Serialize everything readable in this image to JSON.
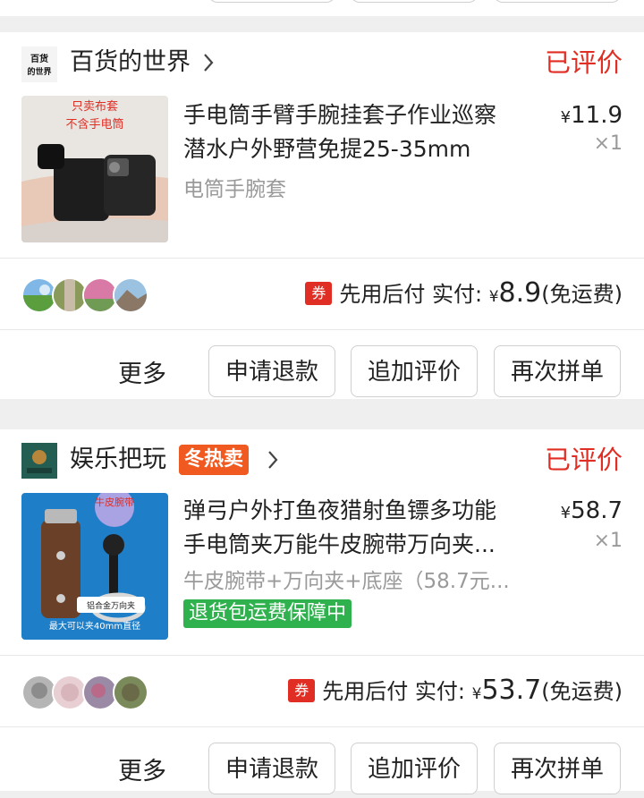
{
  "orders": [
    {
      "shop_name": "百货的世界",
      "shop_logo_text": "百货的世界",
      "status": "已评价",
      "title_line1": "手电筒手臂手腕挂套子作业巡察",
      "title_line2": "潜水户外野营免提25-35mm",
      "sku": "电筒手腕套",
      "price_symbol": "¥",
      "price": "11.9",
      "quantity": "×1",
      "image_text": "只卖布套 不含手电筒",
      "image_text_line1": "只卖布套",
      "image_text_line2": "不含手电筒",
      "coupon_icon": "券",
      "pay_label": "先用后付 实付:",
      "pay_symbol": "¥",
      "pay_amount": "8.9",
      "pay_note": "(免运费)",
      "more": "更多",
      "buttons": [
        "申请退款",
        "追加评价",
        "再次拼单"
      ]
    },
    {
      "shop_name": "娱乐把玩",
      "badge": "冬热卖",
      "status": "已评价",
      "title_line1": "弹弓户外打鱼夜猎射鱼镖多功能",
      "title_line2": "手电筒夹万能牛皮腕带万向夹...",
      "sku": "牛皮腕带+万向夹+底座（58.7元...",
      "guarantee": "退货包运费保障中",
      "price_symbol": "¥",
      "price": "58.7",
      "quantity": "×1",
      "image_text": "牛皮腕带 铝合金万向夹 最大可以夹40mm直径",
      "image_text_top": "牛皮腕带",
      "image_text_mid": "铝合金万向夹",
      "image_text_bottom": "最大可以夹40mm直径",
      "coupon_icon": "券",
      "pay_label": "先用后付 实付:",
      "pay_symbol": "¥",
      "pay_amount": "53.7",
      "pay_note": "(免运费)",
      "more": "更多",
      "buttons": [
        "申请退款",
        "追加评价",
        "再次拼单"
      ]
    }
  ],
  "colors": {
    "accent_red": "#e02e24",
    "badge_orange": "#f0591f",
    "guarantee_green": "#2fb14e",
    "muted_text": "#9a9a9a"
  }
}
